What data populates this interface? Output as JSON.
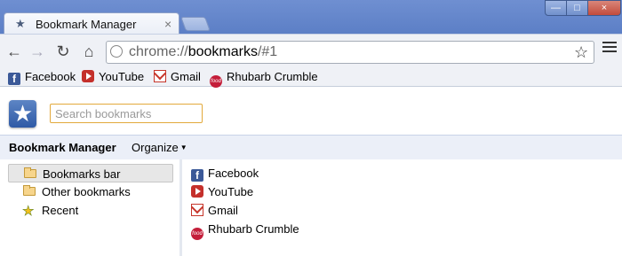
{
  "window": {
    "tab_title": "Bookmark Manager",
    "tab_close": "×",
    "buttons": {
      "minimize": "—",
      "maximize": "□",
      "close": "×"
    }
  },
  "toolbar": {
    "back": "←",
    "forward": "→",
    "reload": "↻",
    "home": "⌂",
    "url_scheme": "chrome://",
    "url_host": "bookmarks",
    "url_path": "/#1",
    "star": "☆"
  },
  "bookmarks_bar": [
    {
      "label": "Facebook",
      "icon": "facebook-icon"
    },
    {
      "label": "YouTube",
      "icon": "youtube-icon"
    },
    {
      "label": "Gmail",
      "icon": "gmail-icon"
    },
    {
      "label": "Rhubarb Crumble",
      "icon": "food-icon"
    }
  ],
  "search": {
    "placeholder": "Search bookmarks"
  },
  "manager": {
    "title": "Bookmark Manager",
    "organize": "Organize"
  },
  "tree": [
    {
      "label": "Bookmarks bar",
      "icon": "folder-icon",
      "selected": true
    },
    {
      "label": "Other bookmarks",
      "icon": "folder-icon",
      "selected": false
    },
    {
      "label": "Recent",
      "icon": "recent-star-icon",
      "selected": false
    }
  ],
  "list": [
    {
      "label": "Facebook",
      "icon": "facebook-icon"
    },
    {
      "label": "YouTube",
      "icon": "youtube-icon"
    },
    {
      "label": "Gmail",
      "icon": "gmail-icon"
    },
    {
      "label": "Rhubarb Crumble",
      "icon": "food-icon"
    }
  ],
  "colors": {
    "titlebar": "#6f8fd1",
    "toolbar": "#eff1f6",
    "manager_bar": "#ebeff8",
    "search_border": "#e2a93b"
  }
}
